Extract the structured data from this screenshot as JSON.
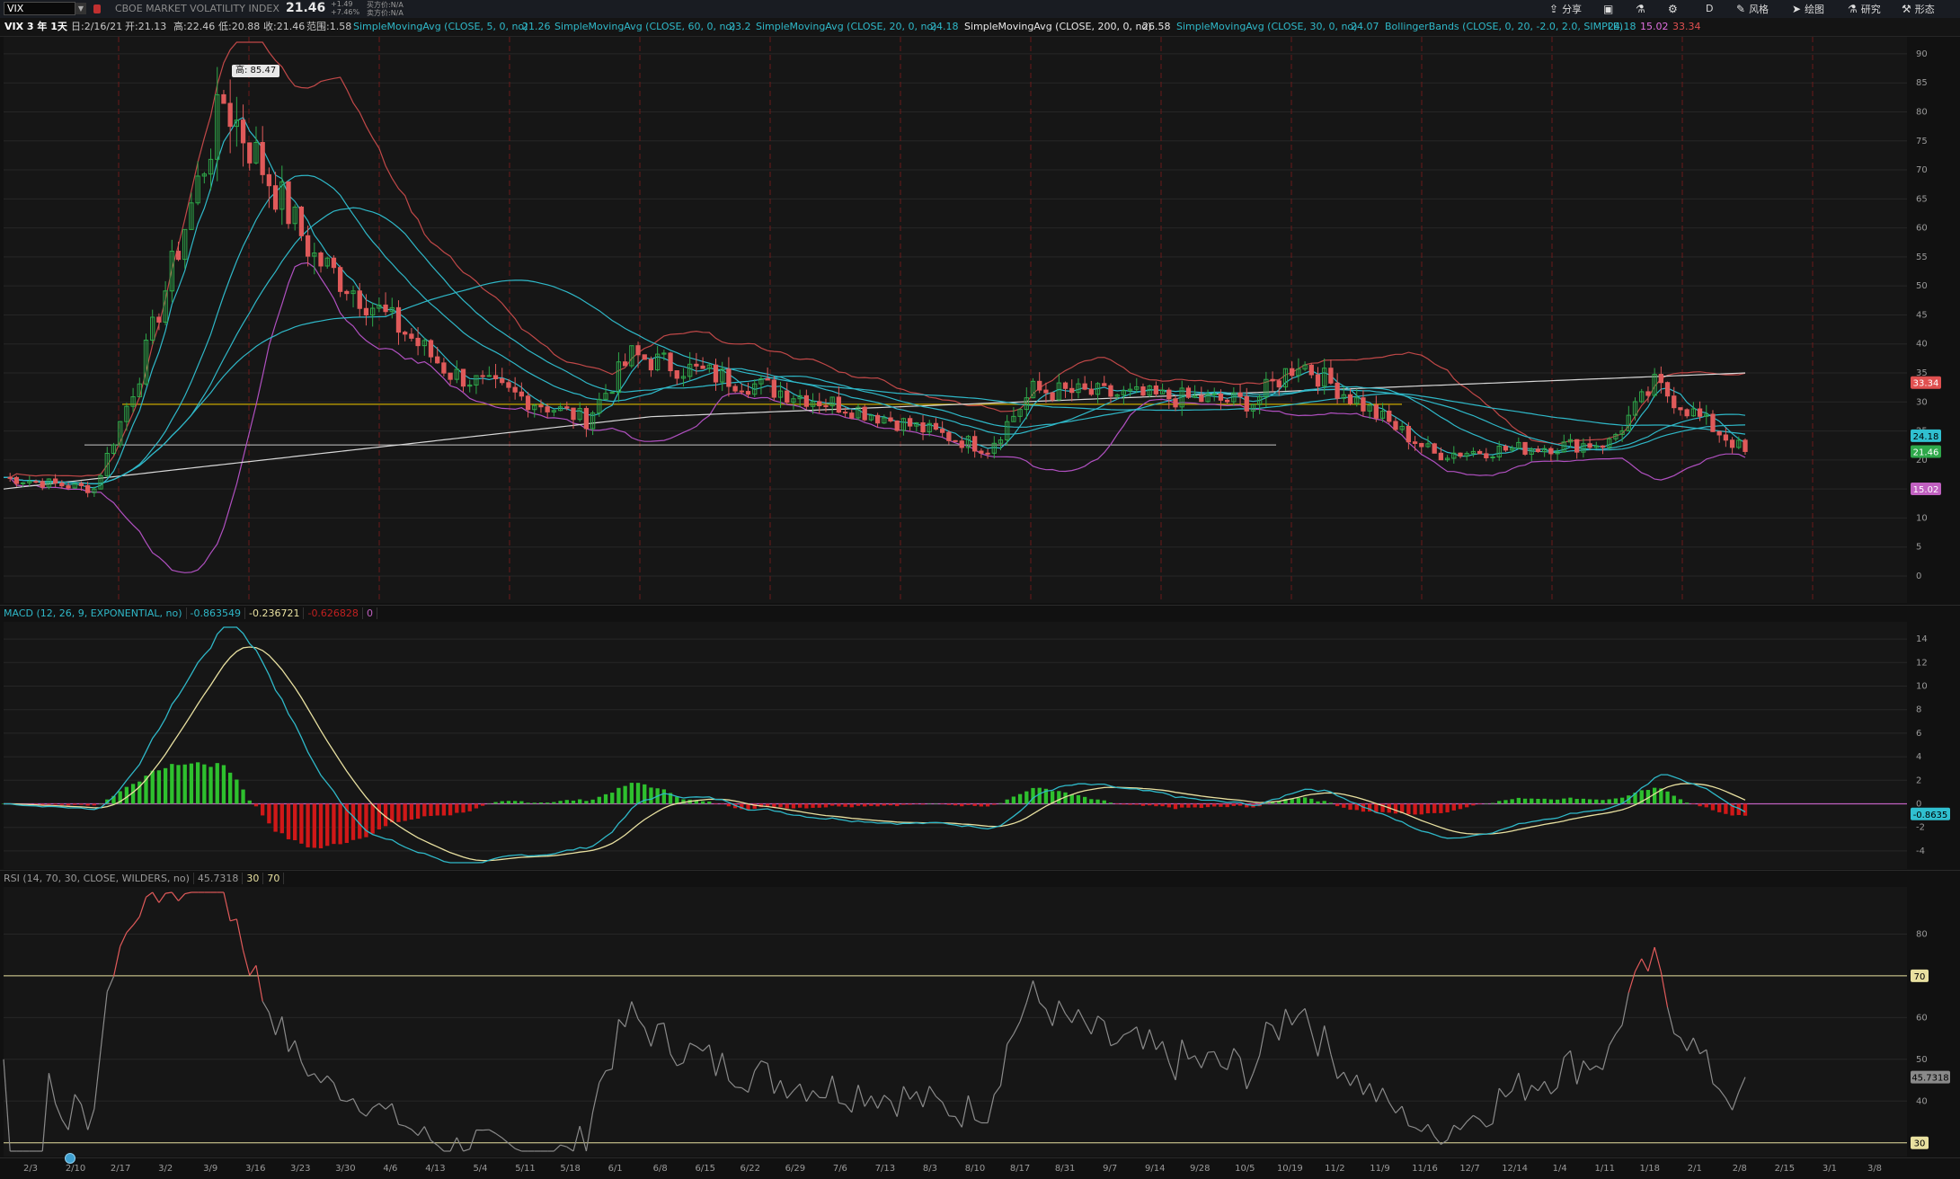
{
  "toolbar": {
    "symbol": "VIX",
    "instrument_name": "CBOE MARKET VOLATILITY INDEX",
    "last_price": "21.46",
    "change": "+1.49",
    "change_pct": "+7.46%",
    "bid_label": "买方价:N/A",
    "ask_label": "卖方价:N/A",
    "share": "分享",
    "period": "D",
    "style": "风格",
    "drawing": "绘图",
    "research": "研究",
    "pattern": "形态"
  },
  "studies_bar": {
    "timeframe": "VIX 3 年 1天",
    "date": "日:2/16/21",
    "open": "开:21.13",
    "high": "高:22.46",
    "low": "低:20.88",
    "close": "收:21.46",
    "range": "范围:1.58",
    "studies": [
      {
        "label": "SimpleMovingAvg (CLOSE, 5, 0, no)",
        "value": "21.26",
        "color": "#2fb8c8"
      },
      {
        "label": "SimpleMovingAvg (CLOSE, 60, 0, no)",
        "value": "23.2",
        "color": "#2fb8c8"
      },
      {
        "label": "SimpleMovingAvg (CLOSE, 20, 0, no)",
        "value": "24.18",
        "color": "#2fb8c8"
      },
      {
        "label": "SimpleMovingAvg (CLOSE, 200, 0, no)",
        "value": "26.58",
        "color": "#e8e8e8"
      },
      {
        "label": "SimpleMovingAvg (CLOSE, 30, 0, no)",
        "value": "24.07",
        "color": "#2fb8c8"
      },
      {
        "label": "BollingerBands (CLOSE, 0, 20, -2.0, 2.0, SIMPLE)",
        "value": "24.18",
        "value2": "15.02",
        "value3": "33.34",
        "color": "#2fb8c8"
      }
    ]
  },
  "price_panel": {
    "high_callout": "高: 85.47",
    "y_ticks": [
      "90",
      "85",
      "80",
      "75",
      "70",
      "65",
      "60",
      "55",
      "50",
      "45",
      "40",
      "35",
      "30",
      "25",
      "20",
      "15",
      "10",
      "5",
      "0"
    ],
    "tags": [
      {
        "value": "33.34",
        "y": 33.34,
        "color": "#e05050",
        "text_color": "#ffffff"
      },
      {
        "value": "24.18",
        "y": 24.18,
        "color": "#30c0d0",
        "text_color": "#000000"
      },
      {
        "value": "21.46",
        "y": 21.46,
        "color": "#2ea84a",
        "text_color": "#ffffff"
      },
      {
        "value": "15.02",
        "y": 15.02,
        "color": "#c060c0",
        "text_color": "#ffffff"
      }
    ],
    "ylim": [
      0,
      92
    ]
  },
  "macd_panel": {
    "header_label": "MACD (12, 26, 9, EXPONENTIAL, no)",
    "value": "-0.863549",
    "avg": "-0.236721",
    "diff": "-0.626828",
    "zero": "0",
    "y_ticks": [
      "14",
      "12",
      "10",
      "8",
      "6",
      "4",
      "2",
      "0",
      "-2",
      "-4"
    ],
    "tag": "-0.8635",
    "ylim": [
      -5,
      15
    ]
  },
  "rsi_panel": {
    "header_label": "RSI (14, 70, 30, CLOSE, WILDERS, no)",
    "value": "45.7318",
    "oversold": "30",
    "overbought": "70",
    "y_ticks": [
      "80",
      "70",
      "60",
      "50",
      "40",
      "30"
    ],
    "tag": "45.7318",
    "ylim": [
      28,
      90
    ]
  },
  "x_axis": {
    "labels": [
      "2/3",
      "2/10",
      "2/17",
      "3/2",
      "3/9",
      "3/16",
      "3/23",
      "3/30",
      "4/6",
      "4/13",
      "5/4",
      "5/11",
      "5/18",
      "6/1",
      "6/8",
      "6/15",
      "6/22",
      "6/29",
      "7/6",
      "7/13",
      "8/3",
      "8/10",
      "8/17",
      "8/31",
      "9/7",
      "9/14",
      "9/28",
      "10/5",
      "10/19",
      "11/2",
      "11/9",
      "11/16",
      "12/7",
      "12/14",
      "1/4",
      "1/11",
      "1/18",
      "2/1",
      "2/8",
      "2/15",
      "3/1",
      "3/8"
    ]
  },
  "chart_data": {
    "type": "line",
    "series": [
      {
        "name": "SimpleMovingAvg (CLOSE, 5, 0, no)",
        "color": "#2fb8c8"
      },
      {
        "name": "SimpleMovingAvg (CLOSE, 200, 0, no)",
        "color": "#e8e8e8"
      },
      {
        "name": "BollingerBands (CLOSE, 0, 20, -2.0, 2.0, SIMPLE)",
        "color": "#e05050"
      }
    ],
    "key_points": [
      {
        "x": "2/3",
        "close": 17
      },
      {
        "x": "2/17",
        "close": 15
      },
      {
        "x": "3/2",
        "close": 35
      },
      {
        "x": "3/16",
        "close": 82
      },
      {
        "x": "3/30",
        "close": 55
      },
      {
        "x": "4/13",
        "close": 42
      },
      {
        "x": "5/4",
        "close": 35
      },
      {
        "x": "6/1",
        "close": 27
      },
      {
        "x": "6/8",
        "close": 38
      },
      {
        "x": "7/13",
        "close": 29
      },
      {
        "x": "8/17",
        "close": 22
      },
      {
        "x": "8/31",
        "close": 32
      },
      {
        "x": "10/19",
        "close": 30
      },
      {
        "x": "11/2",
        "close": 37
      },
      {
        "x": "12/7",
        "close": 21
      },
      {
        "x": "1/18",
        "close": 23
      },
      {
        "x": "2/1",
        "close": 33
      },
      {
        "x": "2/15",
        "close": 21.46
      }
    ]
  }
}
